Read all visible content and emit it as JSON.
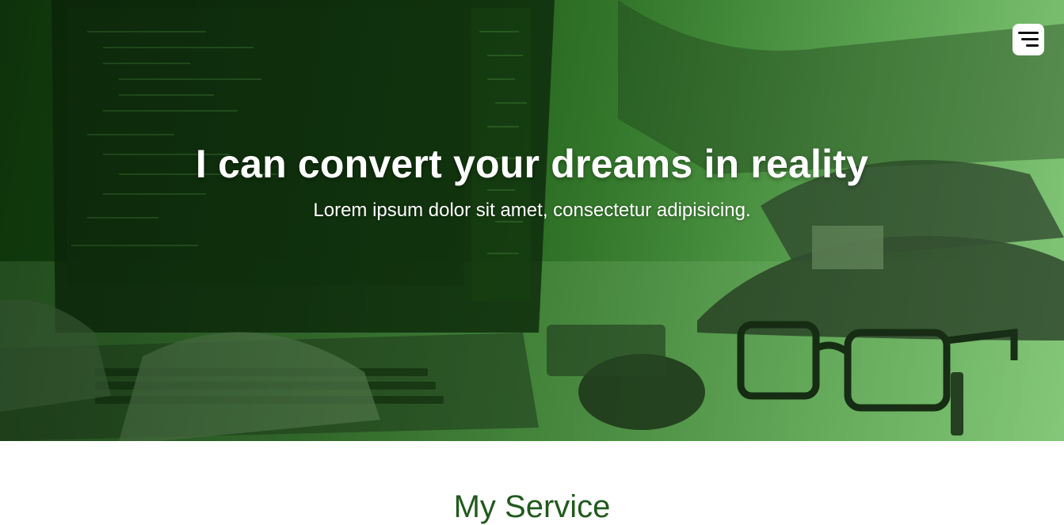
{
  "hero": {
    "title": "I can convert your dreams in reality",
    "subtitle": "Lorem ipsum dolor sit amet, consectetur adipisicing.",
    "image_icon": "laptop-code-desk-photo"
  },
  "menu": {
    "icon": "hamburger-menu-icon"
  },
  "services": {
    "heading": "My Service"
  },
  "colors": {
    "accent": "#215a1c",
    "hero_tint_dark": "#143f10",
    "hero_tint_light": "#8fd084",
    "text_on_hero": "#ffffff"
  }
}
